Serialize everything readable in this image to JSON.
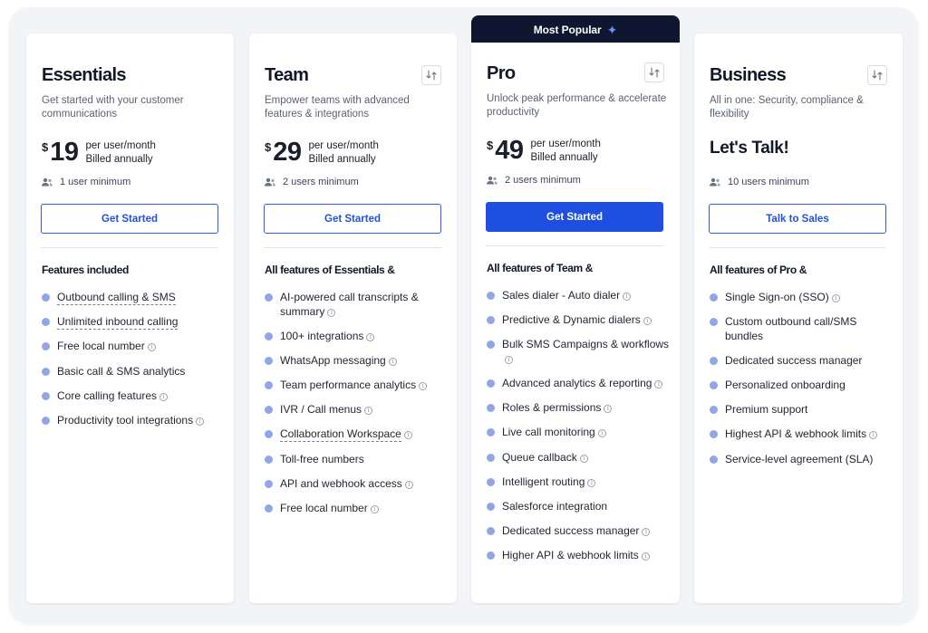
{
  "colors": {
    "accent": "#1f4fe0",
    "ribbon_bg": "#0f1730",
    "bullet": "#8fa6e8",
    "card_bg": "#ffffff",
    "canvas_bg": "#f3f4f7"
  },
  "ribbon": {
    "label": "Most Popular",
    "icon": "sparkle-icon"
  },
  "plans": [
    {
      "name": "Essentials",
      "description": "Get started with your customer communications",
      "currency": "$",
      "price": "19",
      "price_unit": "per user/month",
      "billing": "Billed annually",
      "minimum": "1 user minimum",
      "cta": "Get Started",
      "features_heading": "Features included",
      "features": [
        {
          "text": "Outbound calling & SMS",
          "info": false,
          "underline": true
        },
        {
          "text": "Unlimited inbound calling",
          "info": false,
          "underline": true
        },
        {
          "text": "Free local number",
          "info": true,
          "underline": false
        },
        {
          "text": "Basic call & SMS analytics",
          "info": false,
          "underline": false
        },
        {
          "text": "Core calling features",
          "info": true,
          "underline": false
        },
        {
          "text": "Productivity tool integrations",
          "info": true,
          "underline": false
        }
      ]
    },
    {
      "name": "Team",
      "description": "Empower teams with advanced features & integrations",
      "currency": "$",
      "price": "29",
      "price_unit": "per user/month",
      "billing": "Billed annually",
      "minimum": "2 users minimum",
      "cta": "Get Started",
      "features_heading": "All features of Essentials &",
      "features": [
        {
          "text": "AI-powered call transcripts & summary",
          "info": true,
          "underline": false
        },
        {
          "text": "100+ integrations",
          "info": true,
          "underline": false
        },
        {
          "text": "WhatsApp messaging",
          "info": true,
          "underline": false
        },
        {
          "text": "Team performance analytics",
          "info": true,
          "underline": false
        },
        {
          "text": "IVR / Call menus",
          "info": true,
          "underline": false
        },
        {
          "text": "Collaboration Workspace",
          "info": true,
          "underline": true
        },
        {
          "text": "Toll-free numbers",
          "info": false,
          "underline": false
        },
        {
          "text": "API and webhook access",
          "info": true,
          "underline": false
        },
        {
          "text": "Free local number",
          "info": true,
          "underline": false
        }
      ]
    },
    {
      "name": "Pro",
      "description": "Unlock peak performance & accelerate productivity",
      "currency": "$",
      "price": "49",
      "price_unit": "per user/month",
      "billing": "Billed annually",
      "minimum": "2 users minimum",
      "cta": "Get Started",
      "features_heading": "All features of Team &",
      "features": [
        {
          "text": "Sales dialer - Auto dialer",
          "info": true,
          "underline": false
        },
        {
          "text": "Predictive & Dynamic dialers",
          "info": true,
          "underline": false
        },
        {
          "text": "Bulk SMS Campaigns & workflows",
          "info": true,
          "underline": false
        },
        {
          "text": "Advanced analytics & reporting",
          "info": true,
          "underline": false
        },
        {
          "text": "Roles & permissions",
          "info": true,
          "underline": false
        },
        {
          "text": "Live call monitoring",
          "info": true,
          "underline": false
        },
        {
          "text": "Queue callback",
          "info": true,
          "underline": false
        },
        {
          "text": "Intelligent routing",
          "info": true,
          "underline": false
        },
        {
          "text": "Salesforce integration",
          "info": false,
          "underline": false
        },
        {
          "text": "Dedicated success manager",
          "info": true,
          "underline": false
        },
        {
          "text": "Higher API & webhook limits",
          "info": true,
          "underline": false
        }
      ]
    },
    {
      "name": "Business",
      "description": "All in one: Security, compliance & flexibility",
      "headline": "Let's Talk!",
      "minimum": "10 users minimum",
      "cta": "Talk to Sales",
      "features_heading": "All features of Pro &",
      "features": [
        {
          "text": "Single Sign-on (SSO)",
          "info": true,
          "underline": false
        },
        {
          "text": "Custom outbound call/SMS bundles",
          "info": false,
          "underline": false
        },
        {
          "text": "Dedicated success manager",
          "info": false,
          "underline": false
        },
        {
          "text": "Personalized onboarding",
          "info": false,
          "underline": false
        },
        {
          "text": "Premium support",
          "info": false,
          "underline": false
        },
        {
          "text": "Highest API & webhook limits",
          "info": true,
          "underline": false
        },
        {
          "text": "Service-level agreement (SLA)",
          "info": false,
          "underline": false
        }
      ]
    }
  ]
}
